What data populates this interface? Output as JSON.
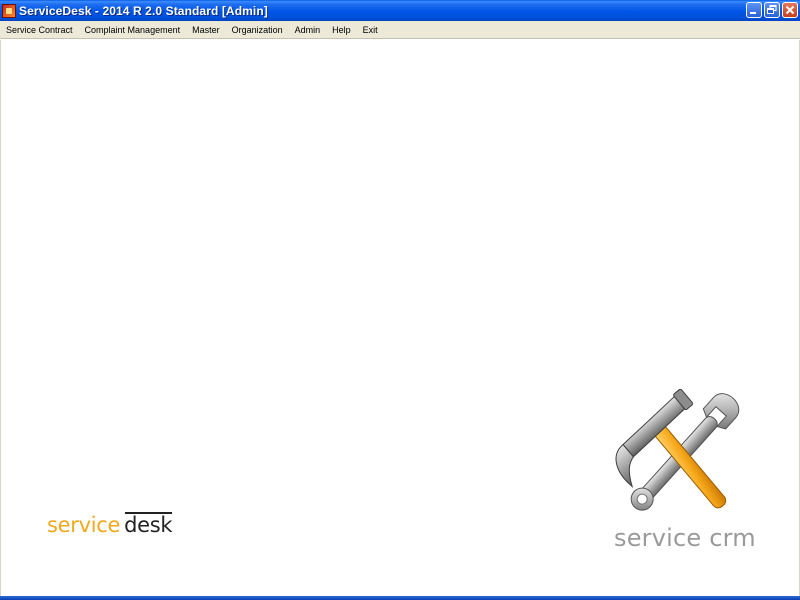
{
  "window": {
    "title": "ServiceDesk - 2014 R 2.0 Standard [Admin]",
    "controls": [
      "minimize-icon",
      "restore-icon",
      "close-icon"
    ]
  },
  "menu": {
    "items": [
      "Service Contract",
      "Complaint Management",
      "Master",
      "Organization",
      "Admin",
      "Help",
      "Exit"
    ]
  },
  "branding": {
    "service_desk_word1": "service",
    "service_desk_word2": "desk",
    "crm_text": "service crm",
    "tools_icon": "hammer-wrench-icon"
  },
  "colors": {
    "titlebar": "#0055e5",
    "menubar": "#ece9d8",
    "service_accent": "#f0a81c",
    "crm_text": "#9a9a9a"
  }
}
